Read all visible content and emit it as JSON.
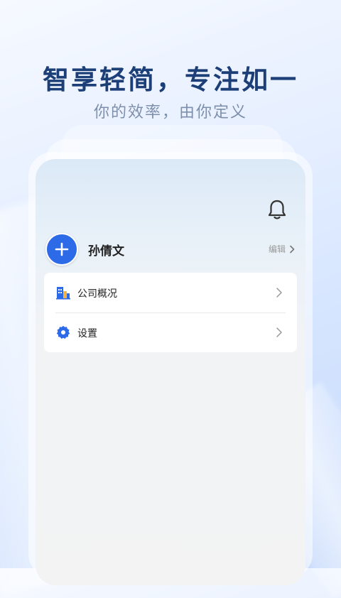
{
  "promo": {
    "headline": "智享轻简，专注如一",
    "subline": "你的效率，由你定义"
  },
  "profile": {
    "name": "孙倩文",
    "edit_label": "编辑"
  },
  "menu": {
    "items": [
      {
        "label": "公司概况",
        "icon": "building-icon"
      },
      {
        "label": "设置",
        "icon": "gear-icon"
      }
    ]
  },
  "colors": {
    "accent": "#2d6ae8",
    "headline": "#1c3f78"
  }
}
